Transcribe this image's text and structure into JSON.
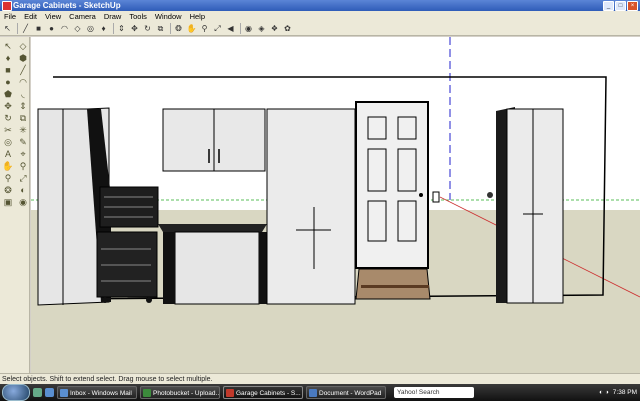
{
  "window": {
    "title": "Garage Cabinets - SketchUp",
    "buttons": {
      "minimize": "_",
      "maximize": "□",
      "close": "×"
    }
  },
  "menu": [
    "File",
    "Edit",
    "View",
    "Camera",
    "Draw",
    "Tools",
    "Window",
    "Help"
  ],
  "toolbar": {
    "tools": [
      {
        "name": "select-icon",
        "glyph": "↖"
      },
      {
        "name": "line-icon",
        "glyph": "╱"
      },
      {
        "name": "rectangle-icon",
        "glyph": "■"
      },
      {
        "name": "circle-icon",
        "glyph": "●"
      },
      {
        "name": "arc-icon",
        "glyph": "◠"
      },
      {
        "name": "eraser-icon",
        "glyph": "◇"
      },
      {
        "name": "tape-measure-icon",
        "glyph": "◎"
      },
      {
        "name": "paint-bucket-icon",
        "glyph": "♦"
      },
      {
        "name": "push-pull-icon",
        "glyph": "⇕"
      },
      {
        "name": "move-icon",
        "glyph": "✥"
      },
      {
        "name": "rotate-icon",
        "glyph": "↻"
      },
      {
        "name": "offset-icon",
        "glyph": "⧉"
      },
      {
        "name": "orbit-icon",
        "glyph": "❂"
      },
      {
        "name": "pan-icon",
        "glyph": "✋"
      },
      {
        "name": "zoom-icon",
        "glyph": "⚲"
      },
      {
        "name": "zoom-extents-icon",
        "glyph": "⤢"
      },
      {
        "name": "previous-view-icon",
        "glyph": "◀"
      },
      {
        "name": "get-models-icon",
        "glyph": "◉"
      },
      {
        "name": "share-model-icon",
        "glyph": "◈"
      },
      {
        "name": "components-icon",
        "glyph": "❖"
      },
      {
        "name": "google-earth-icon",
        "glyph": "✿"
      }
    ]
  },
  "left_tools": [
    "↖",
    "◇",
    "♦",
    "⬢",
    "■",
    "╱",
    "●",
    "◠",
    "⬟",
    "◟",
    "✥",
    "⇕",
    "↻",
    "⧉",
    "✂",
    "✳",
    "◎",
    "✎",
    "A",
    "⌖",
    "✋",
    "⚲",
    "⚲",
    "⤢",
    "❂",
    "◐",
    "▣",
    "◉"
  ],
  "status": {
    "text": "Select objects. Shift to extend select. Drag mouse to select multiple."
  },
  "taskbar": {
    "tasks": [
      {
        "label": "Inbox - Windows Mail",
        "color": "#5a8fd0"
      },
      {
        "label": "Photobucket - Upload...",
        "color": "#3c8b3c"
      },
      {
        "label": "Garage Cabinets - S...",
        "color": "#c0392b",
        "active": true
      },
      {
        "label": "Document - WordPad",
        "color": "#4a7ac0"
      }
    ],
    "search": "Yahoo! Search",
    "clock": "7:38 PM"
  },
  "scene": {
    "colors": {
      "sky": "#ffffff",
      "ground": "#d9d7c2",
      "red_axis": "#c33",
      "green_axis": "#2a2",
      "blue_axis": "#22c",
      "floor_rug": "#a88a6b"
    }
  }
}
